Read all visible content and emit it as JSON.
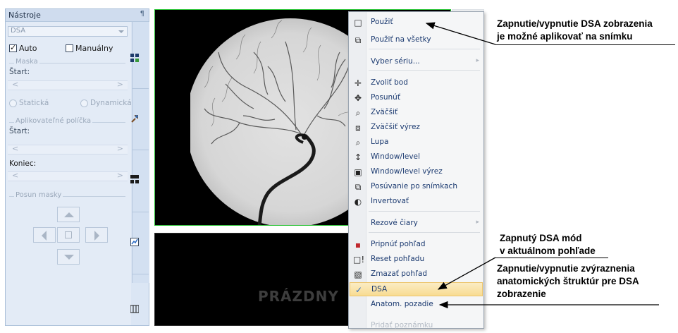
{
  "tools_panel": {
    "title": "Nástroje",
    "pin": "¶",
    "series_select": "DSA",
    "auto_label": "Auto",
    "auto_checked": true,
    "manual_label": "Manuálny",
    "manual_checked": false,
    "mask_group": "Maska",
    "mask_start_label": "Štart:",
    "static_label": "Statická",
    "dynamic_label": "Dynamická",
    "frames_group": "Aplikovateľné políčka",
    "frames_start_label": "Štart:",
    "frames_end_label": "Koniec:",
    "shift_group": "Posun masky",
    "scroll_left": "<",
    "scroll_right": ">"
  },
  "viewer": {
    "empty_label": "PRÁZDNY"
  },
  "context_menu": {
    "items": [
      {
        "icon": "apply-icon",
        "glyph": "□",
        "label": "Použiť",
        "submenu": false
      },
      {
        "icon": "apply-all-icon",
        "glyph": "⧉",
        "label": "Použiť na všetky",
        "submenu": false
      },
      {
        "icon": "",
        "glyph": "",
        "label": "Vyber sériu...",
        "submenu": true
      },
      {
        "icon": "select-point-icon",
        "glyph": "✛",
        "label": "Zvoliť bod",
        "submenu": false
      },
      {
        "icon": "pan-icon",
        "glyph": "✥",
        "label": "Posunúť",
        "submenu": false
      },
      {
        "icon": "zoom-icon",
        "glyph": "⌕",
        "label": "Zväčšiť",
        "submenu": false
      },
      {
        "icon": "zoom-region-icon",
        "glyph": "⧈",
        "label": "Zväčšiť výrez",
        "submenu": false
      },
      {
        "icon": "magnifier-icon",
        "glyph": "⌕",
        "label": "Lupa",
        "submenu": false
      },
      {
        "icon": "window-level-icon",
        "glyph": "↕",
        "label": "Window/level",
        "submenu": false
      },
      {
        "icon": "window-level-region-icon",
        "glyph": "▣",
        "label": "Window/level výrez",
        "submenu": false
      },
      {
        "icon": "frame-scroll-icon",
        "glyph": "⧉",
        "label": "Posúvanie po snímkach",
        "submenu": false
      },
      {
        "icon": "invert-icon",
        "glyph": "◐",
        "label": "Invertovať",
        "submenu": false
      },
      {
        "icon": "",
        "glyph": "",
        "label": "Rezové čiary",
        "submenu": true
      },
      {
        "icon": "pin-icon",
        "glyph": "▪",
        "label": "Pripnúť pohľad",
        "submenu": false
      },
      {
        "icon": "reset-icon",
        "glyph": "□!",
        "label": "Reset pohľadu",
        "submenu": false
      },
      {
        "icon": "delete-view-icon",
        "glyph": "▧",
        "label": "Zmazať pohľad",
        "submenu": false
      },
      {
        "icon": "check-icon",
        "glyph": "✓",
        "label": "DSA",
        "submenu": false
      },
      {
        "icon": "",
        "glyph": "",
        "label": "Anatom. pozadie",
        "submenu": false
      },
      {
        "icon": "",
        "glyph": "",
        "label": "Pridať poznámku",
        "submenu": false
      }
    ]
  },
  "annotations": {
    "dsa_toggle_line1": "Zapnutie/vypnutie DSA zobrazenia",
    "dsa_toggle_line2": "je možné aplikovať na snímku",
    "dsa_mode_line1": "Zapnutý DSA mód",
    "dsa_mode_line2": "v aktuálnom pohľade",
    "anat_line1": "Zapnutie/vypnutie zvýraznenia",
    "anat_line2": "anatomických štruktúr pre DSA",
    "anat_line3": "zobrazenie"
  },
  "colors": {
    "menu_highlight": "#f8dc92",
    "active_view_border": "#2fc43a",
    "menu_text": "#1b3a70"
  }
}
